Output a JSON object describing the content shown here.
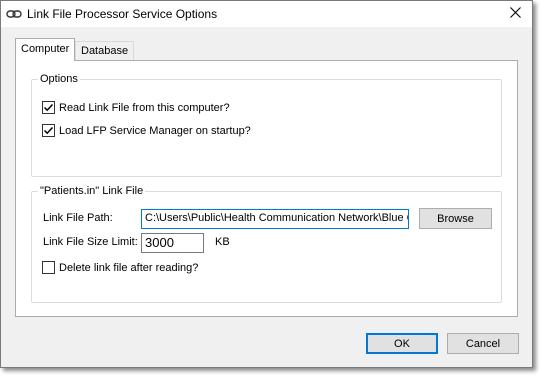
{
  "window": {
    "title": "Link File Processor Service Options"
  },
  "tabs": [
    {
      "label": "Computer",
      "active": true
    },
    {
      "label": "Database",
      "active": false
    }
  ],
  "options_group": {
    "title": "Options",
    "checkboxes": [
      {
        "label": "Read Link File from this computer?",
        "checked": true
      },
      {
        "label": "Load LFP Service Manager on startup?",
        "checked": true
      }
    ]
  },
  "link_file_group": {
    "title": "\"Patients.in\" Link File",
    "path_label": "Link File Path:",
    "path_value": "C:\\Users\\Public\\Health Communication Network\\Blue C",
    "browse_label": "Browse",
    "size_label": "Link File Size Limit:",
    "size_value": "3000",
    "size_unit": "KB",
    "delete_checkbox": {
      "label": "Delete link file after reading?",
      "checked": false
    }
  },
  "footer": {
    "ok_label": "OK",
    "cancel_label": "Cancel"
  },
  "icons": {
    "title": "link-icon",
    "close": "close-icon",
    "check": "checkmark-icon"
  },
  "colors": {
    "focus_accent": "#0078d7",
    "window_bg": "#f0f0f0",
    "panel_bg": "#ffffff"
  }
}
